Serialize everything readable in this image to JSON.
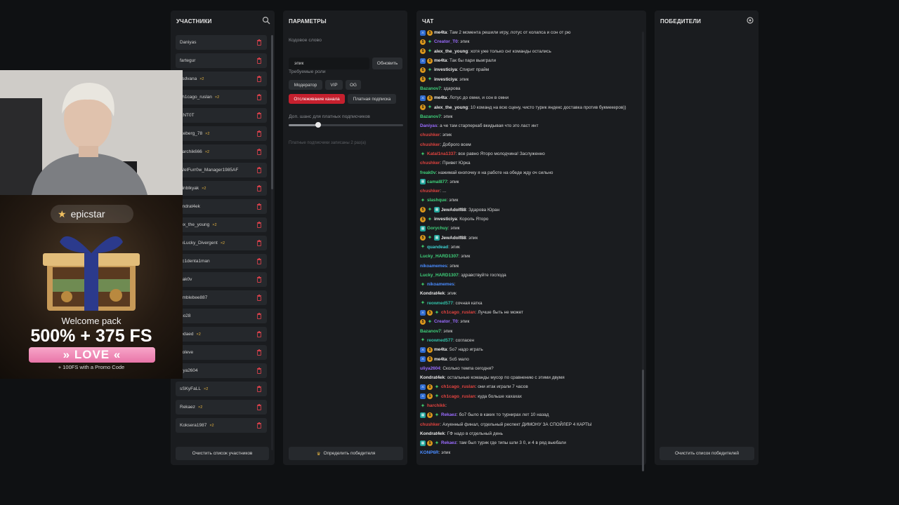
{
  "participants": {
    "title": "УЧАСТНИКИ",
    "items": [
      {
        "name": "Daniyas",
        "badge": ""
      },
      {
        "name": "fartegur",
        "badge": ""
      },
      {
        "name": "ksdvana",
        "badge": "×2"
      },
      {
        "name": "ch1cago_ruslan",
        "badge": "×2"
      },
      {
        "name": "ANT0T",
        "badge": ""
      },
      {
        "name": "iceberg_78",
        "badge": "×2"
      },
      {
        "name": "earchik666",
        "badge": "×2"
      },
      {
        "name": "WelFurr0w_Manager1985AF",
        "badge": ""
      },
      {
        "name": "hinblkyak",
        "badge": "×2"
      },
      {
        "name": "ondrat4ek",
        "badge": ""
      },
      {
        "name": "lex_the_young",
        "badge": "×2"
      },
      {
        "name": "mLucky_Divergent",
        "badge": "×2"
      },
      {
        "name": "cc1denta1man",
        "badge": ""
      },
      {
        "name": "eak0v",
        "badge": ""
      },
      {
        "name": "umblebee887",
        "badge": ""
      },
      {
        "name": "ico28",
        "badge": ""
      },
      {
        "name": "ledaed",
        "badge": "×2"
      },
      {
        "name": "noleve",
        "badge": ""
      },
      {
        "name": "iliya2604",
        "badge": ""
      },
      {
        "name": "sSKyFaLL",
        "badge": "×2"
      },
      {
        "name": "Rekaez",
        "badge": "×2"
      },
      {
        "name": "Koksera1987",
        "badge": "×2"
      }
    ],
    "clear_button": "Очистить список участников"
  },
  "params": {
    "title": "ПАРАМЕТРЫ",
    "keyword_label": "Кодовое слово",
    "keyword_value": "эпик",
    "update_button": "Обновить",
    "roles_label": "Требуемые роли",
    "roles": [
      "Модератор",
      "VIP",
      "OG"
    ],
    "roles2": [
      "Отслеживание канала",
      "Платная подписка"
    ],
    "chance_label": "Доп. шанс для платных подписчиков",
    "chance_fraction": 0.26,
    "chance_hint": "Платные подписчики записаны 2 раз(а)",
    "pick_button": "Определить победителя"
  },
  "chat": {
    "title": "ЧАТ",
    "colors": {
      "green": "#3fd07a",
      "purple": "#9b6cff",
      "red": "#e0433f",
      "blue": "#4a8cff",
      "white": "#e8e8e8",
      "cyan": "#3fd0d0",
      "teal": "#32c0a8"
    },
    "messages": [
      {
        "badges": [
          "bl",
          "gold"
        ],
        "user": "me4ta",
        "color": "#e8e8e8",
        "text": ": Там 2 момента решили игру, лотус от колапса и сон от рю"
      },
      {
        "badges": [
          "gold",
          "gr"
        ],
        "user": "Creator_T0",
        "color": "#9b6cff",
        "text": ": эпик"
      },
      {
        "badges": [
          "gold",
          "gr"
        ],
        "user": "alex_the_young",
        "color": "#e8e8e8",
        "text": ": хотя уже только снг команды остались"
      },
      {
        "badges": [
          "bl",
          "gold"
        ],
        "user": "me4ta",
        "color": "#e8e8e8",
        "text": ": Так бы пари выиграли"
      },
      {
        "badges": [
          "gold",
          "gr"
        ],
        "user": "investiciya",
        "color": "#e8e8e8",
        "text": ": Спирит прайм"
      },
      {
        "badges": [
          "gold",
          "gr"
        ],
        "user": "investiciya",
        "color": "#e8e8e8",
        "text": ": эпик"
      },
      {
        "badges": [],
        "user": "Bazanov7",
        "color": "#3fd07a",
        "text": ": здарова"
      },
      {
        "badges": [
          "bl",
          "gold"
        ],
        "user": "me4ta",
        "color": "#e8e8e8",
        "text": ": Лотус до омни, и сон в омни"
      },
      {
        "badges": [
          "gold",
          "gr"
        ],
        "user": "alex_the_young",
        "color": "#e8e8e8",
        "text": ": 10 команд на всю сцену, чисто турик яндекс доставка против букмекеров))"
      },
      {
        "badges": [],
        "user": "Bazanov7",
        "color": "#3fd07a",
        "text": ": эпик"
      },
      {
        "badges": [],
        "user": "Daniyas",
        "color": "#9b6cff",
        "text": ": а че там старперкаб вкидывая что это ласт инт"
      },
      {
        "badges": [],
        "user": "chushker",
        "color": "#e0433f",
        "text": ": эпик"
      },
      {
        "badges": [],
        "user": "chushker",
        "color": "#e0433f",
        "text": ": Доброго всем"
      },
      {
        "badges": [
          "gr"
        ],
        "user": "Katal1na1337",
        "color": "#e0433f",
        "text": ": все равно Ятоpo молодчина! Заслуженно"
      },
      {
        "badges": [],
        "user": "chushker",
        "color": "#e0433f",
        "text": ": Привет Юрка"
      },
      {
        "badges": [],
        "user": "freak0v",
        "color": "#3fd07a",
        "text": ": нажимай кнопочку я на работе на обеде жду оч сильно"
      },
      {
        "badges": [
          "cyan"
        ],
        "user": "camal877",
        "color": "#3fd07a",
        "text": ": эпик"
      },
      {
        "badges": [],
        "user": "chushker",
        "color": "#e0433f",
        "text": ": ..."
      },
      {
        "badges": [
          "gr"
        ],
        "user": "slashque",
        "color": "#3fd07a",
        "text": ": эпик"
      },
      {
        "badges": [
          "gold",
          "gr",
          "cyan"
        ],
        "user": "JewAdolf88",
        "color": "#e8e8e8",
        "text": ": Здарова Юран"
      },
      {
        "badges": [
          "gold",
          "gr"
        ],
        "user": "investiciya",
        "color": "#e8e8e8",
        "text": ": Король Ятоpo"
      },
      {
        "badges": [
          "cyan"
        ],
        "user": "Gorychuy",
        "color": "#3fd07a",
        "text": ": эпик"
      },
      {
        "badges": [
          "gold",
          "gr",
          "cyan"
        ],
        "user": "JewAdolf88",
        "color": "#e8e8e8",
        "text": ": эпик"
      },
      {
        "badges": [
          "gr"
        ],
        "user": "quandead",
        "color": "#3fd0d0",
        "text": ": эпик"
      },
      {
        "badges": [],
        "user": "Lucky_HARD1307",
        "color": "#3fd07a",
        "text": ": эпик"
      },
      {
        "badges": [],
        "user": "nikoamemes",
        "color": "#4a8cff",
        "text": ": эпик"
      },
      {
        "badges": [],
        "user": "Lucky_HARD1307",
        "color": "#3fd07a",
        "text": ": здравствуйте господа"
      },
      {
        "badges": [
          "gr"
        ],
        "user": "nikoamemes",
        "color": "#4a8cff",
        "text": ": "
      },
      {
        "badges": [],
        "user": "Kondrat4ek",
        "color": "#e8e8e8",
        "text": ": эпик"
      },
      {
        "badges": [
          "gr"
        ],
        "user": "reowned577",
        "color": "#32c0a8",
        "text": ": сочная катка"
      },
      {
        "badges": [
          "bl",
          "gold",
          "gr"
        ],
        "user": "ch1cago_ruslan",
        "color": "#e0433f",
        "text": ": Лучше быть не может"
      },
      {
        "badges": [
          "gold",
          "gr"
        ],
        "user": "Creator_T0",
        "color": "#9b6cff",
        "text": ": эпик"
      },
      {
        "badges": [],
        "user": "Bazanov7",
        "color": "#3fd07a",
        "text": ": эпик"
      },
      {
        "badges": [
          "gr"
        ],
        "user": "reowned577",
        "color": "#32c0a8",
        "text": ": согласен"
      },
      {
        "badges": [
          "bl",
          "gold"
        ],
        "user": "me4ta",
        "color": "#e8e8e8",
        "text": ": 5о7 надо играть"
      },
      {
        "badges": [
          "bl",
          "gold"
        ],
        "user": "me4ta",
        "color": "#e8e8e8",
        "text": ": 5о5 мало"
      },
      {
        "badges": [],
        "user": "uliya2604",
        "color": "#9b6cff",
        "text": ": Сколько темпа сегодня?"
      },
      {
        "badges": [],
        "user": "Kondrat4ek",
        "color": "#e8e8e8",
        "text": ": остальные команды мусор по сравнению с этими двумя"
      },
      {
        "badges": [
          "bl",
          "gold",
          "gr"
        ],
        "user": "ch1cago_ruslan",
        "color": "#e0433f",
        "text": ": они итак играли 7 часов"
      },
      {
        "badges": [
          "bl",
          "gold",
          "gr"
        ],
        "user": "ch1cago_ruslan",
        "color": "#e0433f",
        "text": ": куда больше хахахах"
      },
      {
        "badges": [
          "gr"
        ],
        "user": "harchikk",
        "color": "#e0433f",
        "text": ": "
      },
      {
        "badges": [
          "cyan",
          "gold",
          "gr"
        ],
        "user": "Rekaez",
        "color": "#9b6cff",
        "text": ": бо7 было в каких то турнирах лет 10 назад"
      },
      {
        "badges": [],
        "user": "chushker",
        "color": "#e0433f",
        "text": ": Ахуенный финал, отдельный респект ДИМОНУ ЗА СПОЙЛЕР 4 КАРТЫ"
      },
      {
        "badges": [],
        "user": "Kondrat4ek",
        "color": "#e8e8e8",
        "text": ": ГФ надо в отдельный день"
      },
      {
        "badges": [
          "cyan",
          "gold",
          "gr"
        ],
        "user": "Rekaez",
        "color": "#9b6cff",
        "text": ": там был турик где типы шли 3 0, и 4 в ряд выебали"
      },
      {
        "badges": [],
        "user": "KONP6R",
        "color": "#4a8cff",
        "text": ": эпик"
      }
    ]
  },
  "winners": {
    "title": "ПОБЕДИТЕЛИ",
    "clear_button": "Очистить список победителей"
  },
  "ad": {
    "brand": "epicstar",
    "welcome": "Welcome pack",
    "offer": "500% + 375 FS",
    "code": "» LOVE «",
    "sub": "+ 100FS with a Promo Code"
  }
}
